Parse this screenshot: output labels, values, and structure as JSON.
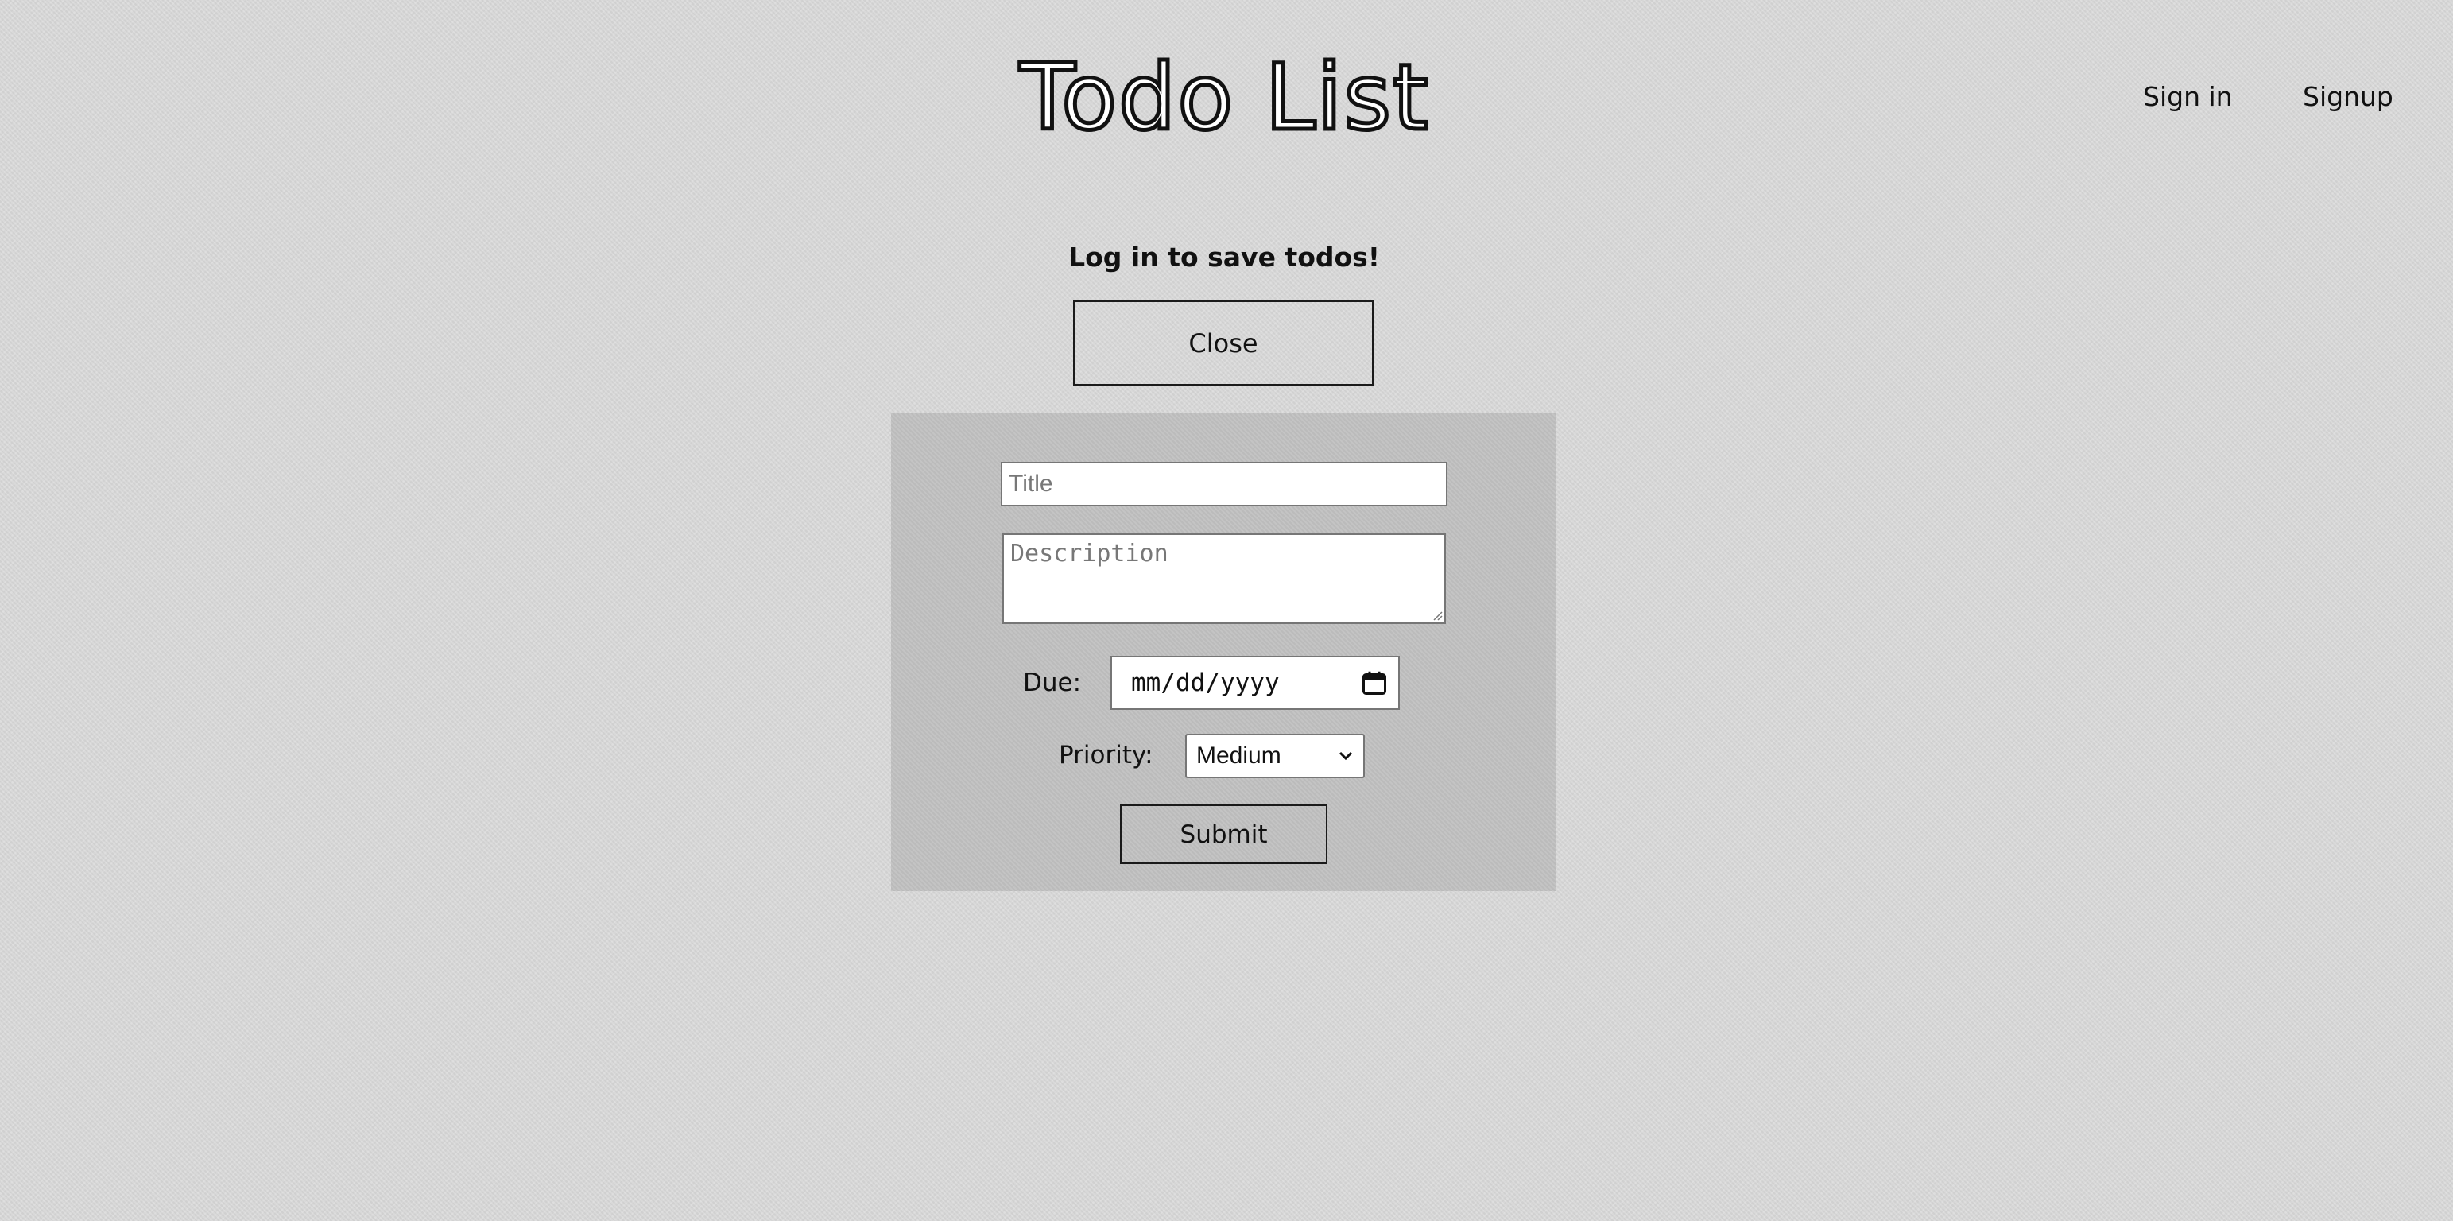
{
  "header": {
    "title": "Todo List",
    "nav": {
      "signin_label": "Sign in",
      "signup_label": "Signup"
    }
  },
  "notice": {
    "message": "Log in to save todos!",
    "close_label": "Close"
  },
  "form": {
    "title_placeholder": "Title",
    "title_value": "",
    "description_placeholder": "Description",
    "description_value": "",
    "due_label": "Due:",
    "due_value": "mm/dd/yyyy",
    "priority_label": "Priority:",
    "priority_value": "Medium",
    "submit_label": "Submit"
  },
  "icons": {
    "calendar": "calendar-icon",
    "dropdown": "chevron-down-icon",
    "resize": "resize-grip-icon"
  },
  "colors": {
    "page_background": "#d9d9d9",
    "form_background": "#bfbfbf",
    "text": "#111111",
    "border": "#1a1a1a",
    "input_border": "#767676"
  }
}
